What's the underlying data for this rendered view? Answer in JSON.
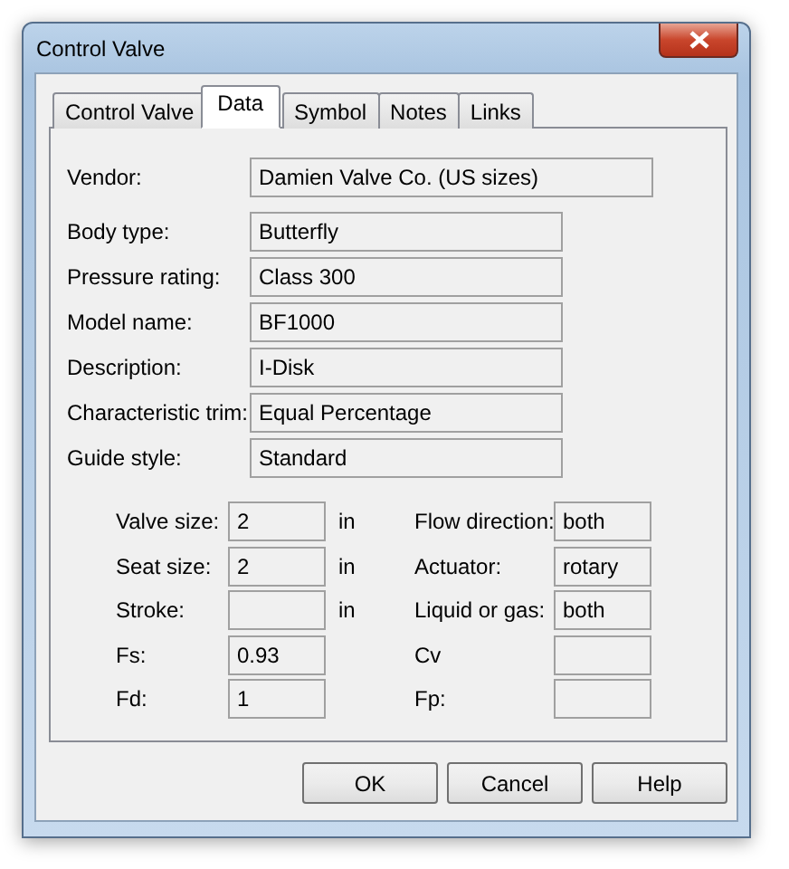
{
  "window": {
    "title": "Control Valve"
  },
  "tabs": [
    {
      "label": "Control Valve",
      "selected": false
    },
    {
      "label": "Data",
      "selected": true
    },
    {
      "label": "Symbol",
      "selected": false
    },
    {
      "label": "Notes",
      "selected": false
    },
    {
      "label": "Links",
      "selected": false
    }
  ],
  "fields": [
    {
      "label": "Vendor:",
      "value": "Damien Valve Co. (US sizes)",
      "kind": "wide"
    },
    {
      "label": "Body type:",
      "value": "Butterfly",
      "kind": "normal"
    },
    {
      "label": "Pressure rating:",
      "value": "Class 300",
      "kind": "normal"
    },
    {
      "label": "Model name:",
      "value": "BF1000",
      "kind": "normal"
    },
    {
      "label": "Description:",
      "value": "I-Disk",
      "kind": "normal"
    },
    {
      "label": "Characteristic trim:",
      "value": "Equal Percentage",
      "kind": "normal"
    },
    {
      "label": "Guide style:",
      "value": "Standard",
      "kind": "normal"
    }
  ],
  "grid": [
    {
      "left": {
        "label": "Valve size:",
        "value": "2",
        "unit": "in"
      },
      "right": {
        "label": "Flow direction:",
        "value": "both"
      }
    },
    {
      "left": {
        "label": "Seat size:",
        "value": "2",
        "unit": "in"
      },
      "right": {
        "label": "Actuator:",
        "value": "rotary"
      }
    },
    {
      "left": {
        "label": "Stroke:",
        "unit": "in"
      },
      "right": {
        "label": "Liquid or gas:",
        "value": "both"
      }
    },
    {
      "left": {
        "label": "Fs:",
        "value": "0.93"
      },
      "right": {
        "label": "Cv"
      }
    },
    {
      "left": {
        "label": "Fd:",
        "value": "1"
      },
      "right": {
        "label": "Fp:"
      }
    }
  ],
  "buttons": [
    "OK",
    "Cancel",
    "Help"
  ]
}
